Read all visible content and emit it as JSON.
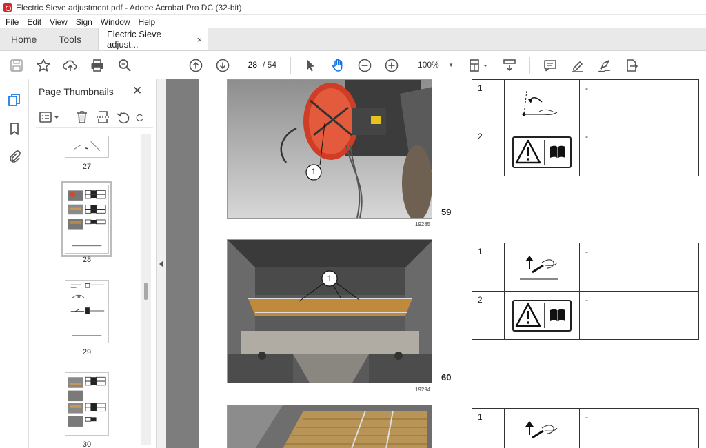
{
  "window": {
    "title": "Electric Sieve adjustment.pdf - Adobe Acrobat Pro DC (32-bit)"
  },
  "menu": [
    "File",
    "Edit",
    "View",
    "Sign",
    "Window",
    "Help"
  ],
  "tabs": {
    "home": "Home",
    "tools": "Tools",
    "document": "Electric Sieve adjust...",
    "close": "×"
  },
  "toolbar": {
    "page_current": "28",
    "page_total": "/ 54",
    "zoom": "100%"
  },
  "panel": {
    "title": "Page Thumbnails",
    "close": "✕",
    "thumbnails": [
      {
        "label": "27"
      },
      {
        "label": "28",
        "selected": true
      },
      {
        "label": "29"
      },
      {
        "label": "30"
      }
    ]
  },
  "document": {
    "figures": [
      {
        "number": "59",
        "image_id": "19285"
      },
      {
        "number": "60",
        "image_id": "19294"
      }
    ],
    "photo_callout": "1",
    "tables": [
      {
        "rows": [
          {
            "num": "1",
            "icon": "pull-lever-symbol",
            "desc": "-"
          },
          {
            "num": "2",
            "icon": "warning-read-manual-symbol",
            "desc": "-"
          }
        ]
      },
      {
        "rows": [
          {
            "num": "1",
            "icon": "wrench-up-symbol",
            "desc": "-"
          },
          {
            "num": "2",
            "icon": "warning-read-manual-symbol",
            "desc": "-"
          }
        ]
      },
      {
        "rows": [
          {
            "num": "1",
            "icon": "wrench-up-symbol",
            "desc": "-"
          }
        ]
      }
    ]
  },
  "colors": {
    "tabbar": "#e9e9e9",
    "doc_background": "#7d7d7d",
    "selected_hand_tool": "#1473e6"
  }
}
